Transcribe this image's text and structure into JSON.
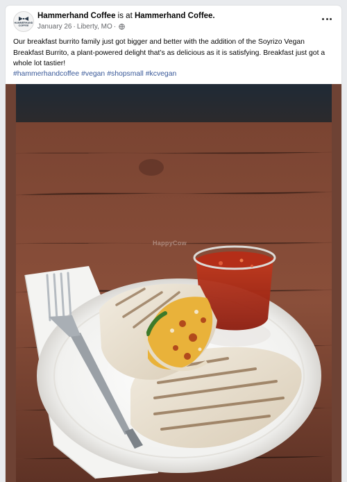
{
  "post": {
    "page_name": "Hammerhand Coffee",
    "is_at_text": "is at",
    "location_name": "Hammerhand Coffee.",
    "date": "January 26",
    "separator": "·",
    "city": "Liberty, MO",
    "privacy_icon": "globe-icon",
    "more_icon": "more-options-icon",
    "body": "Our breakfast burrito family just got bigger and better with the addition of the Soyrizo Vegan Breakfast Burrito, a plant-powered delight that’s as delicious as it is satisfying. Breakfast just got a whole lot tastier!",
    "hashtags": [
      "#hammerhandcoffee",
      "#vegan",
      "#shopsmall",
      "#kcvegan"
    ],
    "avatar_text": [
      "HAMMERHAND",
      "COFFEE"
    ]
  },
  "photo": {
    "watermark": "HappyCow"
  },
  "colors": {
    "link": "#385898",
    "text": "#050505",
    "meta": "#65676b",
    "background": "#e9ebee"
  }
}
